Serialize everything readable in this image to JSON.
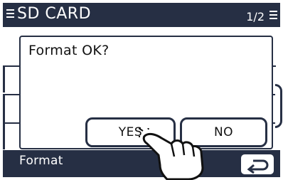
{
  "header": {
    "title": "SD CARD",
    "page_indicator": "1/2",
    "menu_icon": "list-icon",
    "page_icon": "list-icon"
  },
  "dialog": {
    "message": "Format OK?",
    "yes_label": "YES",
    "no_label": "NO"
  },
  "footer": {
    "selected_item": "Format",
    "back_icon": "return-arrow-icon"
  },
  "colors": {
    "frame": "#262f44",
    "background": "#ffffff"
  }
}
